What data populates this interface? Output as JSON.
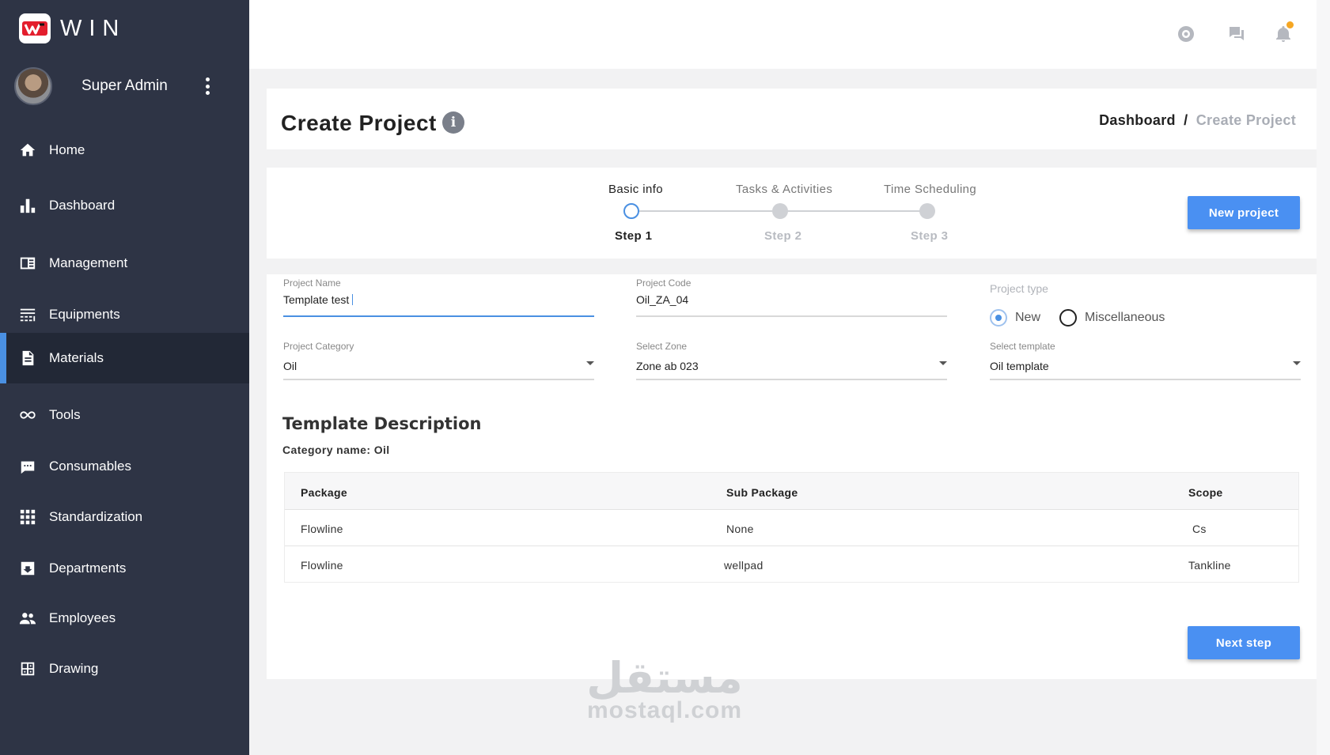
{
  "brand": {
    "name": "WIN"
  },
  "user": {
    "name": "Super Admin"
  },
  "nav": [
    {
      "label": "Home",
      "icon": "home-icon"
    },
    {
      "label": "Dashboard",
      "icon": "bar-chart-icon"
    },
    {
      "label": "Management",
      "icon": "management-icon"
    },
    {
      "label": "Equipments",
      "icon": "equipments-icon"
    },
    {
      "label": "Materials",
      "icon": "document-icon",
      "active": true
    },
    {
      "label": "Tools",
      "icon": "infinity-icon"
    },
    {
      "label": "Consumables",
      "icon": "chat-dots-icon"
    },
    {
      "label": "Standardization",
      "icon": "grid-icon"
    },
    {
      "label": "Departments",
      "icon": "archive-icon"
    },
    {
      "label": "Employees",
      "icon": "people-icon"
    },
    {
      "label": "Drawing",
      "icon": "drawing-icon"
    }
  ],
  "topbar": {
    "icons": [
      "support-icon",
      "chat-icon",
      "bell-icon"
    ]
  },
  "header": {
    "title": "Create Project",
    "breadcrumb": {
      "root": "Dashboard",
      "separator": "/",
      "current": "Create Project"
    }
  },
  "stepper": {
    "steps": [
      {
        "title": "Basic info",
        "step": "Step 1",
        "active": true
      },
      {
        "title": "Tasks & Activities",
        "step": "Step 2",
        "active": false
      },
      {
        "title": "Time Scheduling",
        "step": "Step 3",
        "active": false
      }
    ],
    "new_project_label": "New project"
  },
  "form": {
    "project_name": {
      "label": "Project Name",
      "value": "Template test"
    },
    "project_code": {
      "label": "Project Code",
      "value": "Oil_ZA_04"
    },
    "project_type": {
      "label": "Project type",
      "options": [
        "New",
        "Miscellaneous"
      ],
      "selected": "New"
    },
    "project_category": {
      "label": "Project Category",
      "value": "Oil"
    },
    "select_zone": {
      "label": "Select Zone",
      "value": "Zone ab 023"
    },
    "select_template": {
      "label": "Select template",
      "value": "Oil template"
    }
  },
  "template": {
    "title": "Template Description",
    "category_line": "Category name: Oil",
    "columns": [
      "Package",
      "Sub Package",
      "Scope"
    ],
    "rows": [
      [
        "Flowline",
        "None",
        "Cs"
      ],
      [
        "Flowline",
        "wellpad",
        "Tankline"
      ]
    ]
  },
  "next_step_label": "Next step",
  "watermark": {
    "arabic": "مستقل",
    "latin": "mostaql.com"
  },
  "colors": {
    "sidebar": "#2e3445",
    "sidebar_active": "#222836",
    "accent": "#4a90e2",
    "button": "#4a90f2",
    "notification": "#f5a623"
  }
}
